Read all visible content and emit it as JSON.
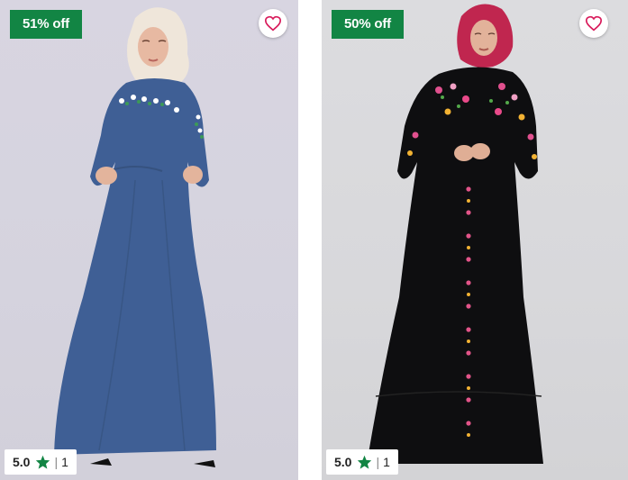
{
  "products": [
    {
      "discount": "51% off",
      "rating": "5.0",
      "separator": "|",
      "review_count": "1",
      "dress_color": "#3f5f95",
      "bg_color": "#d7d4df"
    },
    {
      "discount": "50% off",
      "rating": "5.0",
      "separator": "|",
      "review_count": "1",
      "dress_color": "#0e0e10",
      "bg_color": "#dadadd"
    }
  ],
  "colors": {
    "badge": "#128544",
    "star": "#128544",
    "wishlist_heart": "#d8195a"
  },
  "icons": {
    "wishlist": "heart-outline-icon",
    "rating": "star-icon"
  }
}
